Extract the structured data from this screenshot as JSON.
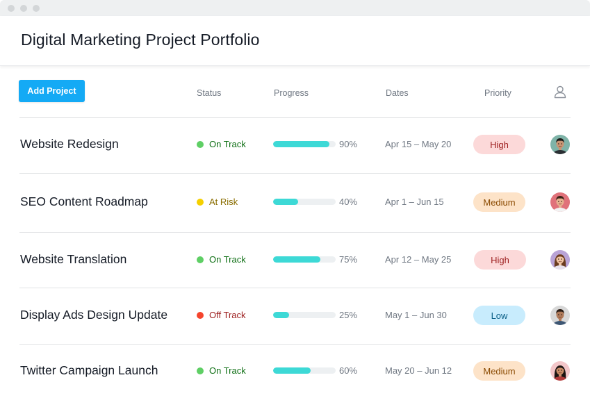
{
  "page": {
    "title": "Digital Marketing Project Portfolio"
  },
  "toolbar": {
    "add_label": "Add Project"
  },
  "columns": {
    "status": "Status",
    "progress": "Progress",
    "dates": "Dates",
    "priority": "Priority",
    "assignee_icon": "person-icon"
  },
  "colors": {
    "accent": "#14aaf5",
    "progress_fill": "#3dd9d6",
    "on_track": "#5fcf65",
    "at_risk": "#f5d000",
    "off_track": "#f5452d",
    "high_bg": "#fcd9d9",
    "medium_bg": "#fde3c8",
    "low_bg": "#c8ecfd"
  },
  "projects": [
    {
      "name": "Website Redesign",
      "status": "On Track",
      "status_color": "#5fcf65",
      "status_text_color": "#0d6e13",
      "progress": 90,
      "progress_label": "90%",
      "dates": "Apr 15 – May 20",
      "priority": "High",
      "priority_bg": "#fcd9d9",
      "priority_color": "#9b1b1b",
      "avatar": "avatar-man-1"
    },
    {
      "name": "SEO Content Roadmap",
      "status": "At Risk",
      "status_color": "#f5d000",
      "status_text_color": "#8a6d00",
      "progress": 40,
      "progress_label": "40%",
      "dates": "Apr 1 – Jun 15",
      "priority": "Medium",
      "priority_bg": "#fde3c8",
      "priority_color": "#8a4a00",
      "avatar": "avatar-man-2"
    },
    {
      "name": "Website Translation",
      "status": "On Track",
      "status_color": "#5fcf65",
      "status_text_color": "#0d6e13",
      "progress": 75,
      "progress_label": "75%",
      "dates": "Apr 12 – May 25",
      "priority": "High",
      "priority_bg": "#fcd9d9",
      "priority_color": "#9b1b1b",
      "avatar": "avatar-woman-1"
    },
    {
      "name": "Display Ads Design Update",
      "status": "Off Track",
      "status_color": "#f5452d",
      "status_text_color": "#9b1b1b",
      "progress": 25,
      "progress_label": "25%",
      "dates": "May 1 – Jun 30",
      "priority": "Low",
      "priority_bg": "#c8ecfd",
      "priority_color": "#0a5f87",
      "avatar": "avatar-man-3"
    },
    {
      "name": "Twitter Campaign Launch",
      "status": "On Track",
      "status_color": "#5fcf65",
      "status_text_color": "#0d6e13",
      "progress": 60,
      "progress_label": "60%",
      "dates": "May 20 – Jun 12",
      "priority": "Medium",
      "priority_bg": "#fde3c8",
      "priority_color": "#8a4a00",
      "avatar": "avatar-woman-2"
    }
  ]
}
